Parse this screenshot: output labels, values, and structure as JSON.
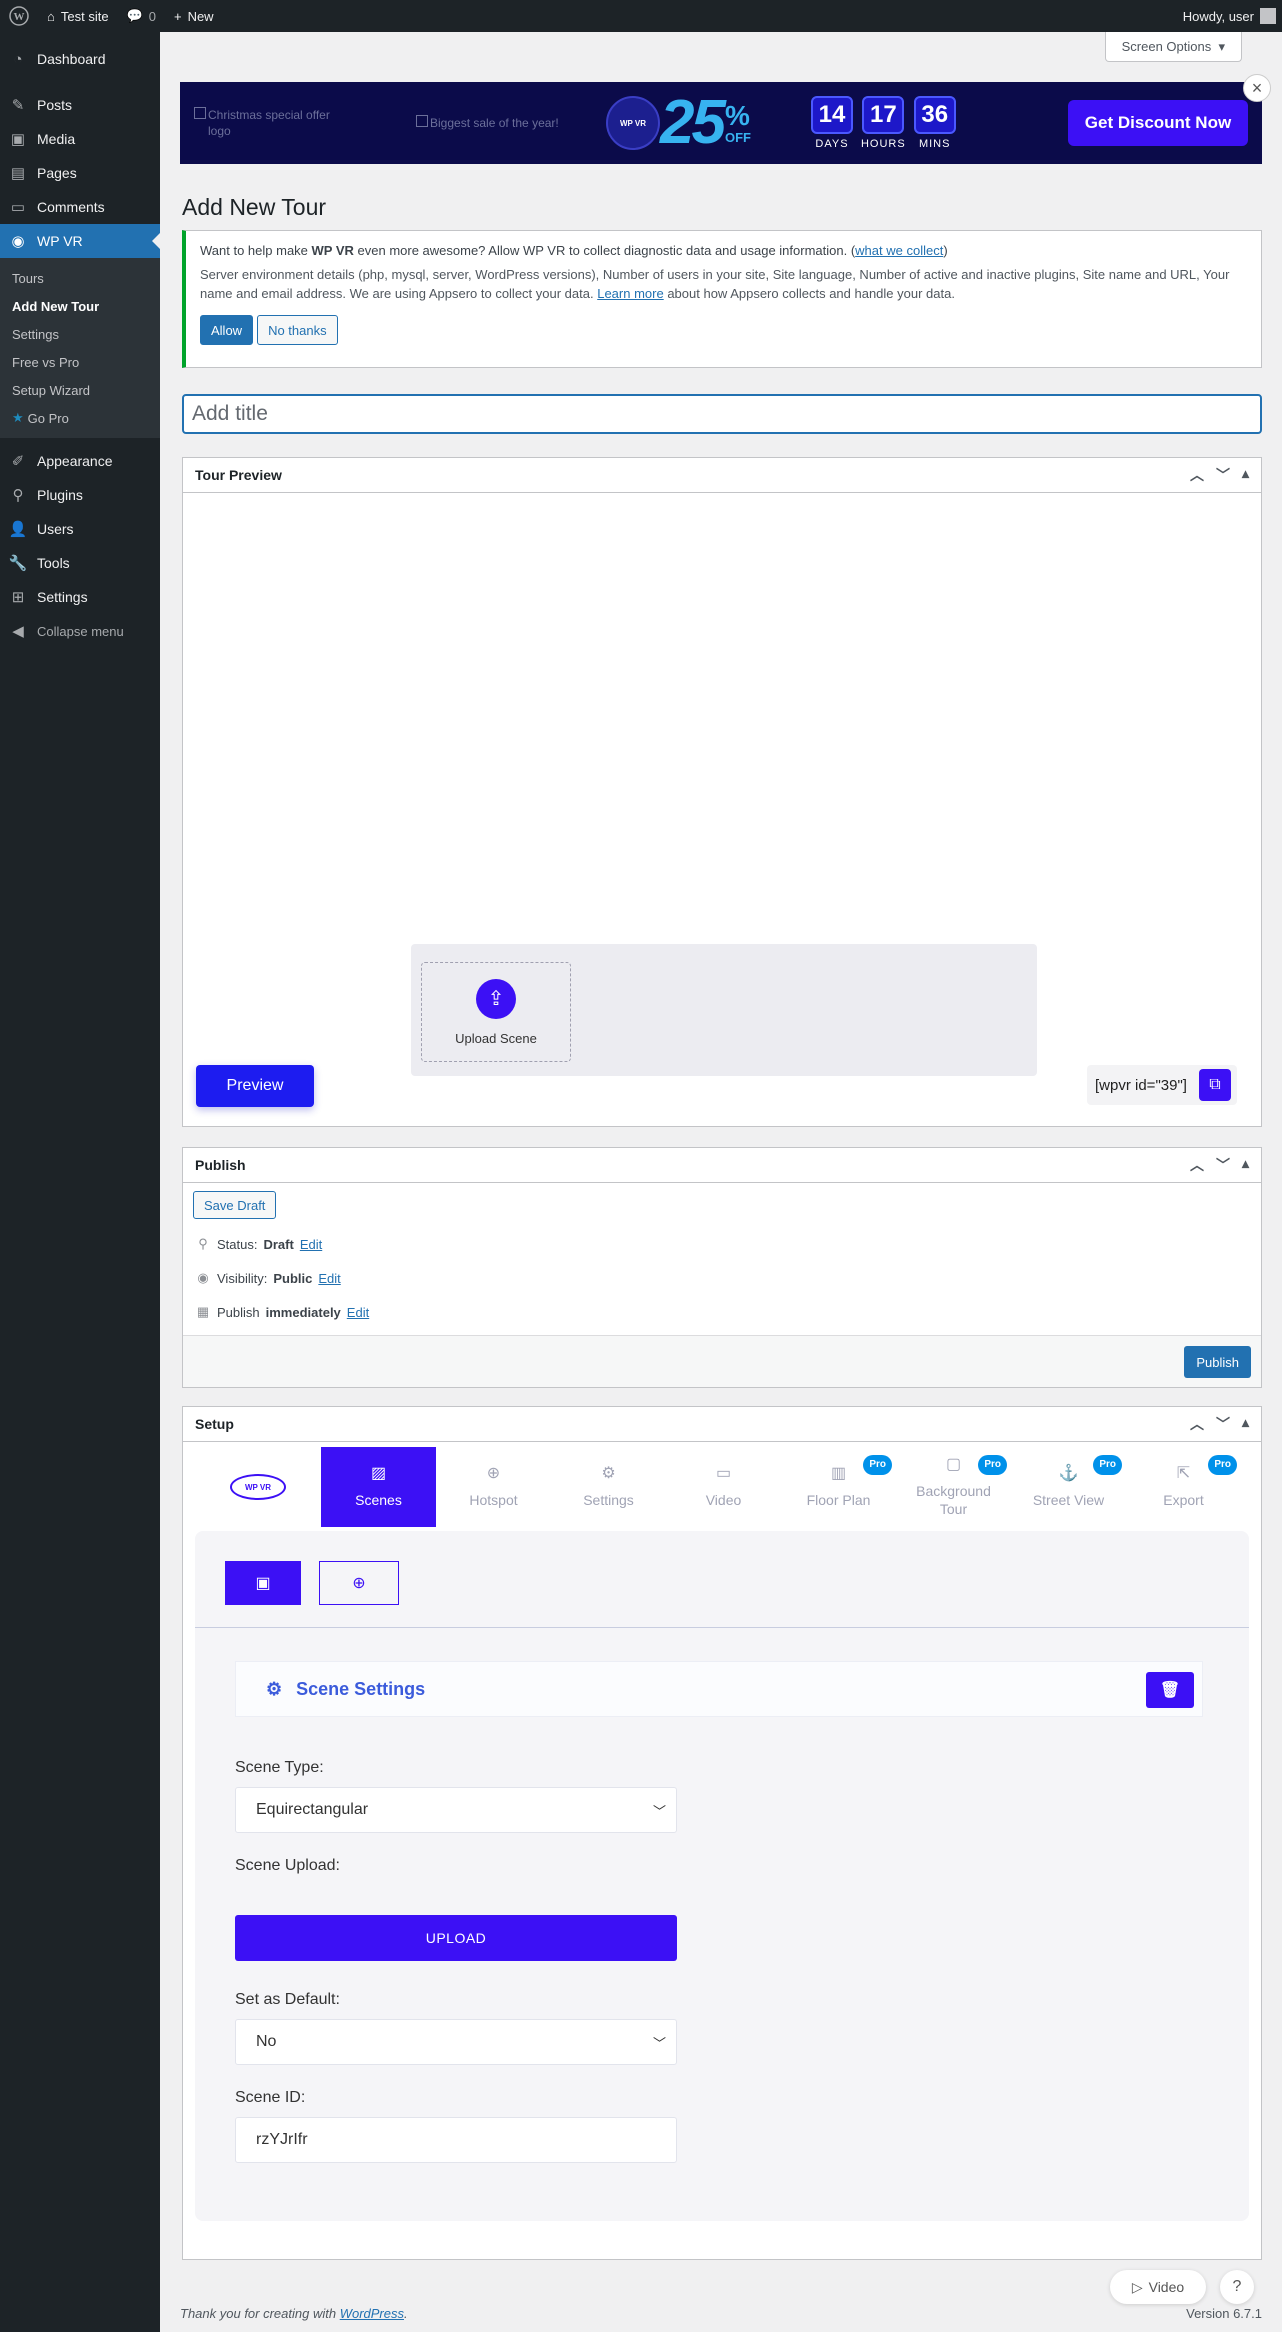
{
  "adminbar": {
    "site_name": "Test site",
    "comments_count": "0",
    "new_label": "New",
    "howdy": "Howdy, user"
  },
  "sidebar": {
    "items_top": [
      {
        "label": "Dashboard",
        "icon": "dashboard-icon"
      },
      {
        "label": "Posts",
        "icon": "pin-icon"
      },
      {
        "label": "Media",
        "icon": "media-icon"
      },
      {
        "label": "Pages",
        "icon": "pages-icon"
      },
      {
        "label": "Comments",
        "icon": "comment-icon"
      },
      {
        "label": "WP VR",
        "icon": "wpvr-icon"
      }
    ],
    "submenu": [
      "Tours",
      "Add New Tour",
      "Settings",
      "Free vs Pro",
      "Setup Wizard",
      "Go Pro"
    ],
    "items_bottom": [
      {
        "label": "Appearance",
        "icon": "brush-icon"
      },
      {
        "label": "Plugins",
        "icon": "plugin-icon"
      },
      {
        "label": "Users",
        "icon": "users-icon"
      },
      {
        "label": "Tools",
        "icon": "wrench-icon"
      },
      {
        "label": "Settings",
        "icon": "settings-icon"
      },
      {
        "label": "Collapse menu",
        "icon": "collapse-icon"
      }
    ]
  },
  "screen_options": "Screen Options",
  "banner": {
    "alt_logo": "Christmas special offer logo",
    "alt_sale": "Biggest sale of the year!",
    "logo_text": "WP VR",
    "percent": "25",
    "pct_sign": "%",
    "off": "OFF",
    "timer": [
      {
        "num": "14",
        "label": "DAYS"
      },
      {
        "num": "17",
        "label": "HOURS"
      },
      {
        "num": "36",
        "label": "MINS"
      }
    ],
    "cta": "Get Discount Now"
  },
  "page_title": "Add New Tour",
  "notice": {
    "q_before": "Want to help make ",
    "q_bold": "WP VR",
    "q_after": " even more awesome? Allow WP VR to collect diagnostic data and usage information. (",
    "q_link": "what we collect",
    "q_close": ")",
    "details_before": "Server environment details (php, mysql, server, WordPress versions), Number of users in your site, Site language, Number of active and inactive plugins, Site name and URL, Your name and email address. We are using Appsero to collect your data. ",
    "details_link": "Learn more",
    "details_after": " about how Appsero collects and handle your data.",
    "allow": "Allow",
    "no_thanks": "No thanks"
  },
  "title_placeholder": "Add title",
  "tour_preview": {
    "heading": "Tour Preview",
    "upload_scene": "Upload Scene",
    "preview_btn": "Preview",
    "shortcode": "[wpvr id=\"39\"]"
  },
  "publish": {
    "heading": "Publish",
    "save_draft": "Save Draft",
    "status_label": "Status: ",
    "status_value": "Draft",
    "visibility_label": "Visibility: ",
    "visibility_value": "Public",
    "publish_label": "Publish ",
    "publish_value": "immediately",
    "edit": "Edit",
    "publish_btn": "Publish"
  },
  "setup": {
    "heading": "Setup",
    "logo_text": "WP VR",
    "tabs": [
      {
        "label": "Scenes",
        "icon": "image-icon",
        "pro": false
      },
      {
        "label": "Hotspot",
        "icon": "crosshair-icon",
        "pro": false
      },
      {
        "label": "Settings",
        "icon": "gear-icon",
        "pro": false
      },
      {
        "label": "Video",
        "icon": "video-icon",
        "pro": false
      },
      {
        "label": "Floor Plan",
        "icon": "map-icon",
        "pro": true
      },
      {
        "label": "Background Tour",
        "icon": "background-icon",
        "pro": true
      },
      {
        "label": "Street View",
        "icon": "pegman-icon",
        "pro": true
      },
      {
        "label": "Export",
        "icon": "export-icon",
        "pro": true
      }
    ],
    "pro_badge": "Pro",
    "scene_settings": "Scene Settings",
    "scene_type_label": "Scene Type:",
    "scene_type_value": "Equirectangular",
    "scene_upload_label": "Scene Upload:",
    "upload_btn": "UPLOAD",
    "default_label": "Set as Default:",
    "default_value": "No",
    "scene_id_label": "Scene ID:",
    "scene_id_value": "rzYJrIfr"
  },
  "footer": {
    "thank_you": "Thank you for creating with ",
    "wp_link": "WordPress",
    "period": ".",
    "version": "Version 6.7.1",
    "video_btn": "Video",
    "help_btn": "?"
  }
}
